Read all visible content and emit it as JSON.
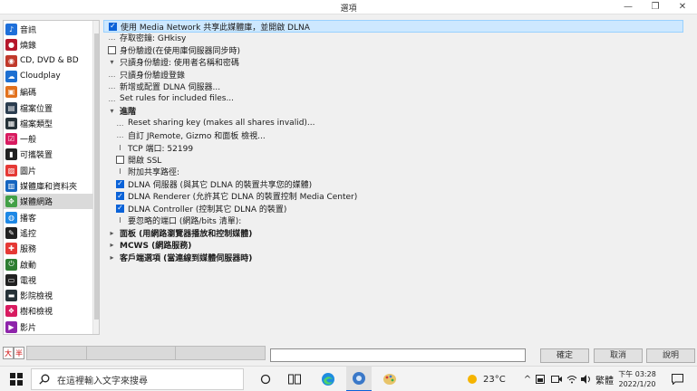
{
  "window": {
    "title": "選項",
    "restore_glyph": "❐",
    "close_glyph": "✕"
  },
  "sidebar": {
    "items": [
      {
        "label": "音訊",
        "icon": "music-note-icon",
        "color": "#1e6fd9",
        "glyph": "♪"
      },
      {
        "label": "燒錄",
        "icon": "disc-icon",
        "color": "#b5172b",
        "glyph": "●"
      },
      {
        "label": "CD, DVD & BD",
        "icon": "cd-icon",
        "color": "#c0392b",
        "glyph": "◉"
      },
      {
        "label": "Cloudplay",
        "icon": "cloud-icon",
        "color": "#1d6fd1",
        "glyph": "☁"
      },
      {
        "label": "編碼",
        "icon": "encode-icon",
        "color": "#e2711d",
        "glyph": "▣"
      },
      {
        "label": "檔案位置",
        "icon": "folder-icon",
        "color": "#2c3e50",
        "glyph": "▤"
      },
      {
        "label": "檔案類型",
        "icon": "file-type-icon",
        "color": "#263238",
        "glyph": "▦"
      },
      {
        "label": "一般",
        "icon": "general-icon",
        "color": "#d81b60",
        "glyph": "☑"
      },
      {
        "label": "可攜裝置",
        "icon": "portable-device-icon",
        "color": "#212121",
        "glyph": "▮"
      },
      {
        "label": "圖片",
        "icon": "picture-icon",
        "color": "#e53935",
        "glyph": "▨"
      },
      {
        "label": "媒體庫和資料夾",
        "icon": "library-icon",
        "color": "#1565c0",
        "glyph": "▥"
      },
      {
        "label": "媒體網路",
        "icon": "media-network-icon",
        "color": "#43a047",
        "glyph": "✥"
      },
      {
        "label": "播客",
        "icon": "podcast-icon",
        "color": "#1e88e5",
        "glyph": "◍"
      },
      {
        "label": "遙控",
        "icon": "remote-icon",
        "color": "#212121",
        "glyph": "✎"
      },
      {
        "label": "服務",
        "icon": "service-icon",
        "color": "#e53935",
        "glyph": "✚"
      },
      {
        "label": "啟動",
        "icon": "power-icon",
        "color": "#2e7d32",
        "glyph": "⏻"
      },
      {
        "label": "電視",
        "icon": "tv-icon",
        "color": "#212121",
        "glyph": "▭"
      },
      {
        "label": "影院檢視",
        "icon": "theater-icon",
        "color": "#263238",
        "glyph": "▬"
      },
      {
        "label": "樹和檢視",
        "icon": "tree-view-icon",
        "color": "#d81b60",
        "glyph": "❖"
      },
      {
        "label": "影片",
        "icon": "video-icon",
        "color": "#8e24aa",
        "glyph": "▶"
      }
    ],
    "active_index": 11
  },
  "main": {
    "rows": [
      {
        "kind": "checkbox",
        "checked": true,
        "label": "使用 Media Network 共享此媒體庫，並開啟 DLNA",
        "indent": 0,
        "highlight": true
      },
      {
        "kind": "dots",
        "label": "存取密鑰: GHkisy",
        "indent": 0
      },
      {
        "kind": "checkbox",
        "checked": false,
        "label": "身份驗證(在使用庫伺服器同步時)",
        "indent": 0
      },
      {
        "kind": "expanded",
        "label": "只讀身份驗證: 使用者名稱和密碼",
        "indent": 0
      },
      {
        "kind": "dots",
        "label": "只讀身份驗證登錄",
        "indent": 0
      },
      {
        "kind": "dots",
        "label": "新增或配置 DLNA 伺服器...",
        "indent": 0
      },
      {
        "kind": "dots",
        "label": "Set rules for included files...",
        "indent": 0
      },
      {
        "kind": "expanded",
        "label": "進階",
        "indent": 0,
        "bold": true
      },
      {
        "kind": "dots",
        "label": "Reset sharing key (makes all shares invalid)...",
        "indent": 1
      },
      {
        "kind": "dots",
        "label": "自訂 JRemote, Gizmo 和面板 檢視...",
        "indent": 1
      },
      {
        "kind": "text",
        "label": "TCP 端口: 52199",
        "indent": 1
      },
      {
        "kind": "checkbox",
        "checked": false,
        "label": "開啟 SSL",
        "indent": 1
      },
      {
        "kind": "text",
        "label": "附加共享路徑:",
        "indent": 1
      },
      {
        "kind": "checkbox",
        "checked": true,
        "label": "DLNA 伺服器 (與其它 DLNA 的裝置共享您的媒體)",
        "indent": 1
      },
      {
        "kind": "checkbox",
        "checked": true,
        "label": "DLNA Renderer (允許其它 DLNA 的裝置控制 Media Center)",
        "indent": 1
      },
      {
        "kind": "checkbox",
        "checked": true,
        "label": "DLNA Controller (控制其它 DLNA 的裝置)",
        "indent": 1
      },
      {
        "kind": "text",
        "label": "要忽略的端口 (網路/bits 清單):",
        "indent": 1
      },
      {
        "kind": "collapsed",
        "label": "面板 (用網路瀏覽器播放和控制媒體)",
        "indent": 0,
        "bold": true
      },
      {
        "kind": "collapsed",
        "label": "MCWS (網路服務)",
        "indent": 0,
        "bold": true
      },
      {
        "kind": "collapsed",
        "label": "客戶端選項 (當連線到媒體伺服器時)",
        "indent": 0,
        "bold": true
      }
    ]
  },
  "ime": {
    "lang_char": "大",
    "width_char": "半"
  },
  "buttons": {
    "ok": "確定",
    "cancel": "取消",
    "help": "說明"
  },
  "taskbar": {
    "search_placeholder": "在這裡輸入文字來搜尋",
    "weather": "23°C",
    "ime_label": "繁體",
    "time": "下午 03:28",
    "date": "2022/1/20"
  },
  "colors": {
    "accent": "#0a62d8",
    "highlight_bg": "#cde8ff",
    "highlight_border": "#99d1ff"
  }
}
